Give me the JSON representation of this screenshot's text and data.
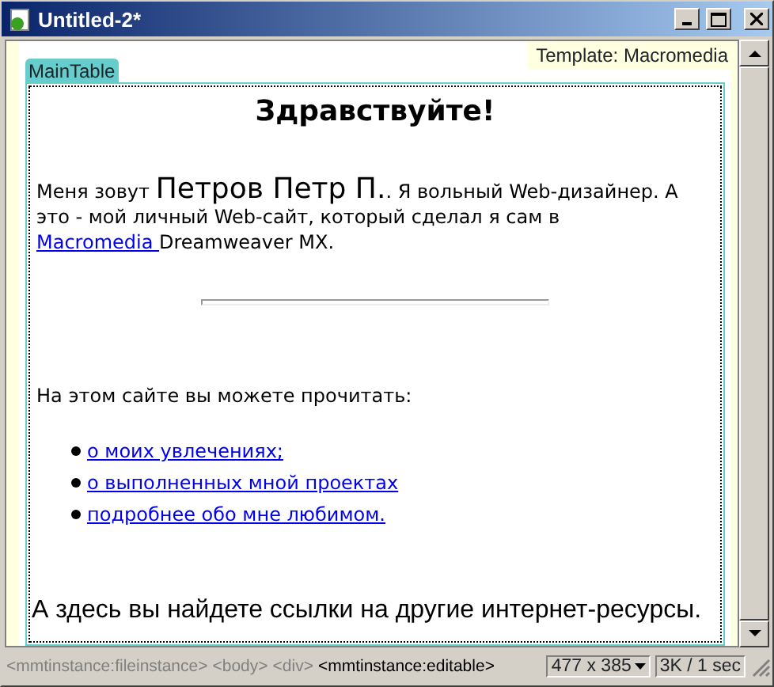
{
  "window": {
    "title": "Untitled-2*"
  },
  "template_label": "Template: Macromedia",
  "region_tab": "MainTable",
  "document": {
    "heading": "Здравствуйте!",
    "intro": [
      {
        "kind": "text",
        "text": "Меня зовут "
      },
      {
        "kind": "large",
        "text": "Петров Петр П."
      },
      {
        "kind": "text",
        "text": ". Я вольный Web-дизайнер. А это - мой личный Web-сайт, который сделал я сам в "
      },
      {
        "kind": "link",
        "text": "Macromedia "
      },
      {
        "kind": "text",
        "text": "Dreamweaver MX."
      }
    ],
    "lead": "На этом сайте вы можете прочитать:",
    "links": [
      "о моих увлечениях;",
      "о выполненных мной проектах",
      "подробнее обо мне любимом."
    ],
    "closing": "А здесь вы найдете ссылки на другие интернет-ресурсы."
  },
  "status_bar": {
    "tags": [
      {
        "text": "<mmtinstance:fileinstance>",
        "selected": false
      },
      {
        "text": "<body>",
        "selected": false
      },
      {
        "text": "<div>",
        "selected": false
      },
      {
        "text": "<mmtinstance:editable>",
        "selected": true
      }
    ],
    "window_size": "477 x 385",
    "download": "3K / 1 sec"
  }
}
